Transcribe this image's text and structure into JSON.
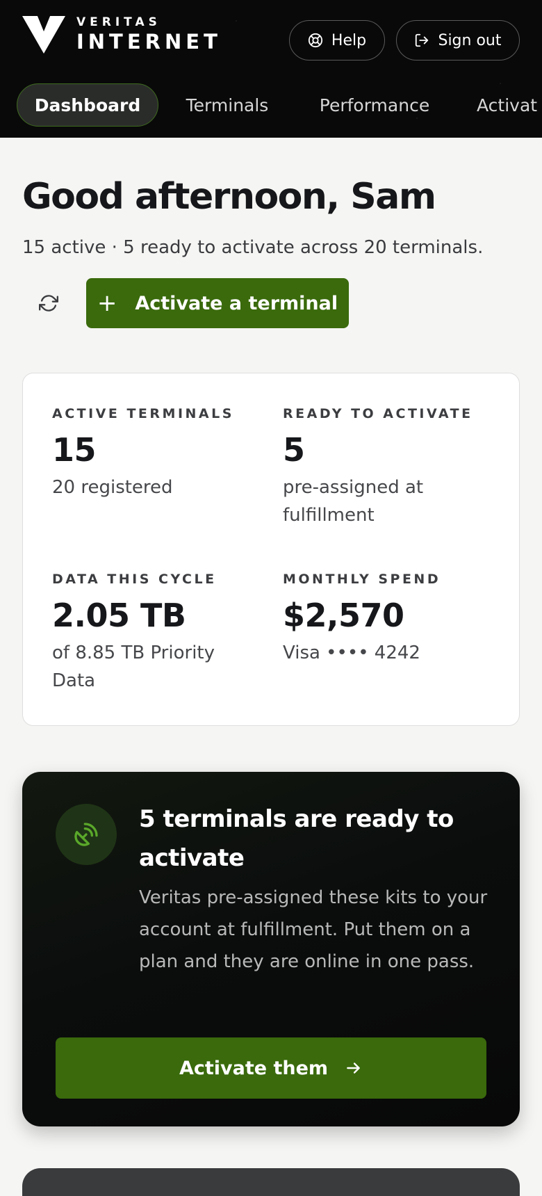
{
  "brand": {
    "top": "VERITAS",
    "bottom": "INTERNET"
  },
  "header": {
    "help_label": "Help",
    "signout_label": "Sign out"
  },
  "tabs": [
    {
      "label": "Dashboard",
      "active": true
    },
    {
      "label": "Terminals"
    },
    {
      "label": "Performance"
    },
    {
      "label": "Activat"
    }
  ],
  "greeting": "Good afternoon, Sam",
  "summary": "15 active · 5 ready to activate across 20 terminals.",
  "actions": {
    "activate_label": "Activate a terminal"
  },
  "stats": [
    {
      "label": "ACTIVE TERMINALS",
      "value": "15",
      "sub": "20 registered"
    },
    {
      "label": "READY TO ACTIVATE",
      "value": "5",
      "sub": "pre-assigned at fulfillment"
    },
    {
      "label": "DATA THIS CYCLE",
      "value": "2.05 TB",
      "sub": "of 8.85 TB Priority Data"
    },
    {
      "label": "MONTHLY SPEND",
      "value": "$2,570",
      "sub": "Visa •••• 4242"
    }
  ],
  "promo": {
    "title": "5 terminals are ready to activate",
    "description": "Veritas pre-assigned these kits to your account at fulfillment. Put them on a plan and they are online in one pass.",
    "button_label": "Activate them"
  },
  "colors": {
    "accent_green": "#3a6a0c",
    "header_bg": "#090909",
    "page_bg": "#f5f5f3",
    "icon_green": "#5aa82a"
  },
  "icons": {
    "logo": "veritas-v-logo",
    "help": "lifebuoy-icon",
    "signout": "sign-out-icon",
    "refresh": "refresh-icon",
    "add": "plus-icon",
    "satellite": "satellite-dish-icon",
    "arrow": "arrow-right-icon"
  }
}
